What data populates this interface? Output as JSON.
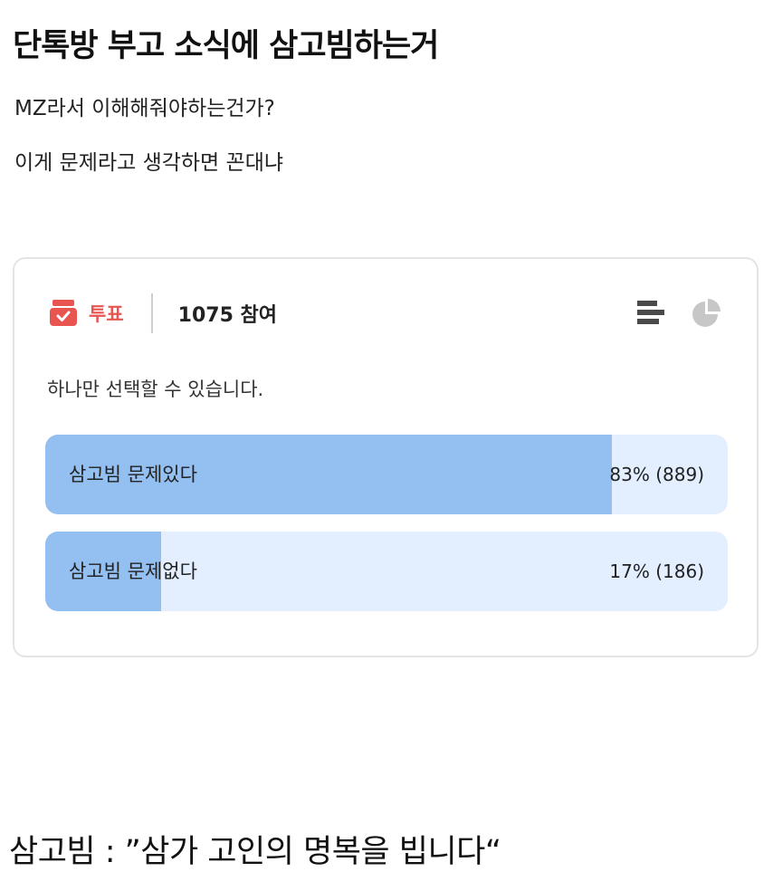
{
  "post": {
    "title": "단톡방 부고 소식에 삼고빔하는거",
    "line1": "MZ라서 이해해줘야하는건가?",
    "line2": "이게 문제라고 생각하면 꼰대냐",
    "footer": "삼고빔 : ”삼가 고인의 명복을 빕니다“"
  },
  "poll": {
    "label": "투표",
    "participants": "1075 참여",
    "instruction": "하나만 선택할 수 있습니다.",
    "accent_color": "#e8544f",
    "icons": [
      "ballot-box-icon",
      "bar-list-icon",
      "pie-chart-icon"
    ],
    "options": [
      {
        "label": "삼고빔 문제있다",
        "result": "83% (889)",
        "percent": 83
      },
      {
        "label": "삼고빔 문제없다",
        "result": "17% (186)",
        "percent": 17
      }
    ]
  }
}
